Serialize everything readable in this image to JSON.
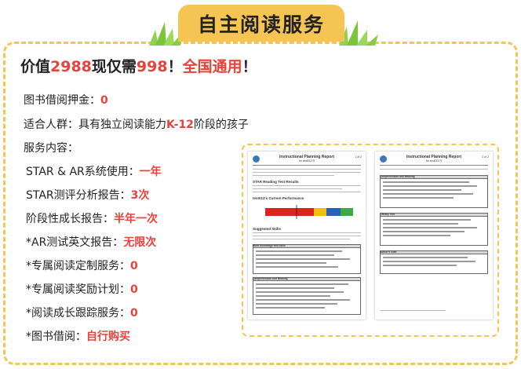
{
  "header": {
    "title": "自主阅读服务"
  },
  "headline": {
    "prefix": "价值",
    "price_value": "2988",
    "middle": "现仅需",
    "price_now": "998",
    "sep": "！",
    "highlight": "全国通用",
    "end": "！"
  },
  "details": [
    {
      "label": "图书借阅押金：",
      "value": "0"
    },
    {
      "label": "适合人群：具有独立阅读能力",
      "value": "K-12",
      "suffix": "阶段的孩子"
    },
    {
      "label": "服务内容：",
      "value": ""
    },
    {
      "label": "STAR & AR系统使用：",
      "value": "一年"
    },
    {
      "label": "STAR测评分析报告：",
      "value": "3次"
    },
    {
      "label": "阶段性成长报告：",
      "value": "半年一次"
    },
    {
      "label": "*AR测试英文报告：",
      "value": "无限次"
    },
    {
      "label": "*专属阅读定制服务：",
      "value": "0"
    },
    {
      "label": "*专属阅读奖励计划：",
      "value": "0"
    },
    {
      "label": "*阅读成长跟踪服务：",
      "value": "0"
    },
    {
      "label": "*图书借阅：",
      "value": "自行购买"
    }
  ],
  "report_left": {
    "title": "Instructional Planning Report",
    "subtitle": "for test013 R",
    "page_num": "1 of 2",
    "section_star": "STAR Reading Test Results",
    "section_perf": "test013's Current Performance",
    "section_skills": "Suggested Skills",
    "box_vocab": "Word Knowledge and Skills",
    "box_comp": "Comprehension and Meaning"
  },
  "report_right": {
    "title": "Instructional Planning Report",
    "subtitle": "for test013 R",
    "page_num": "2 of 2",
    "box_comp": "Comprehension and Meaning",
    "box_lit": "Literary Text",
    "box_craft": "Author's Craft"
  },
  "colors": {
    "accent": "#f6c453",
    "highlight": "#e8423a",
    "chart_red": "#d7261e",
    "chart_yellow": "#f2c200",
    "chart_blue": "#2a62b8",
    "chart_green": "#3ea845"
  }
}
